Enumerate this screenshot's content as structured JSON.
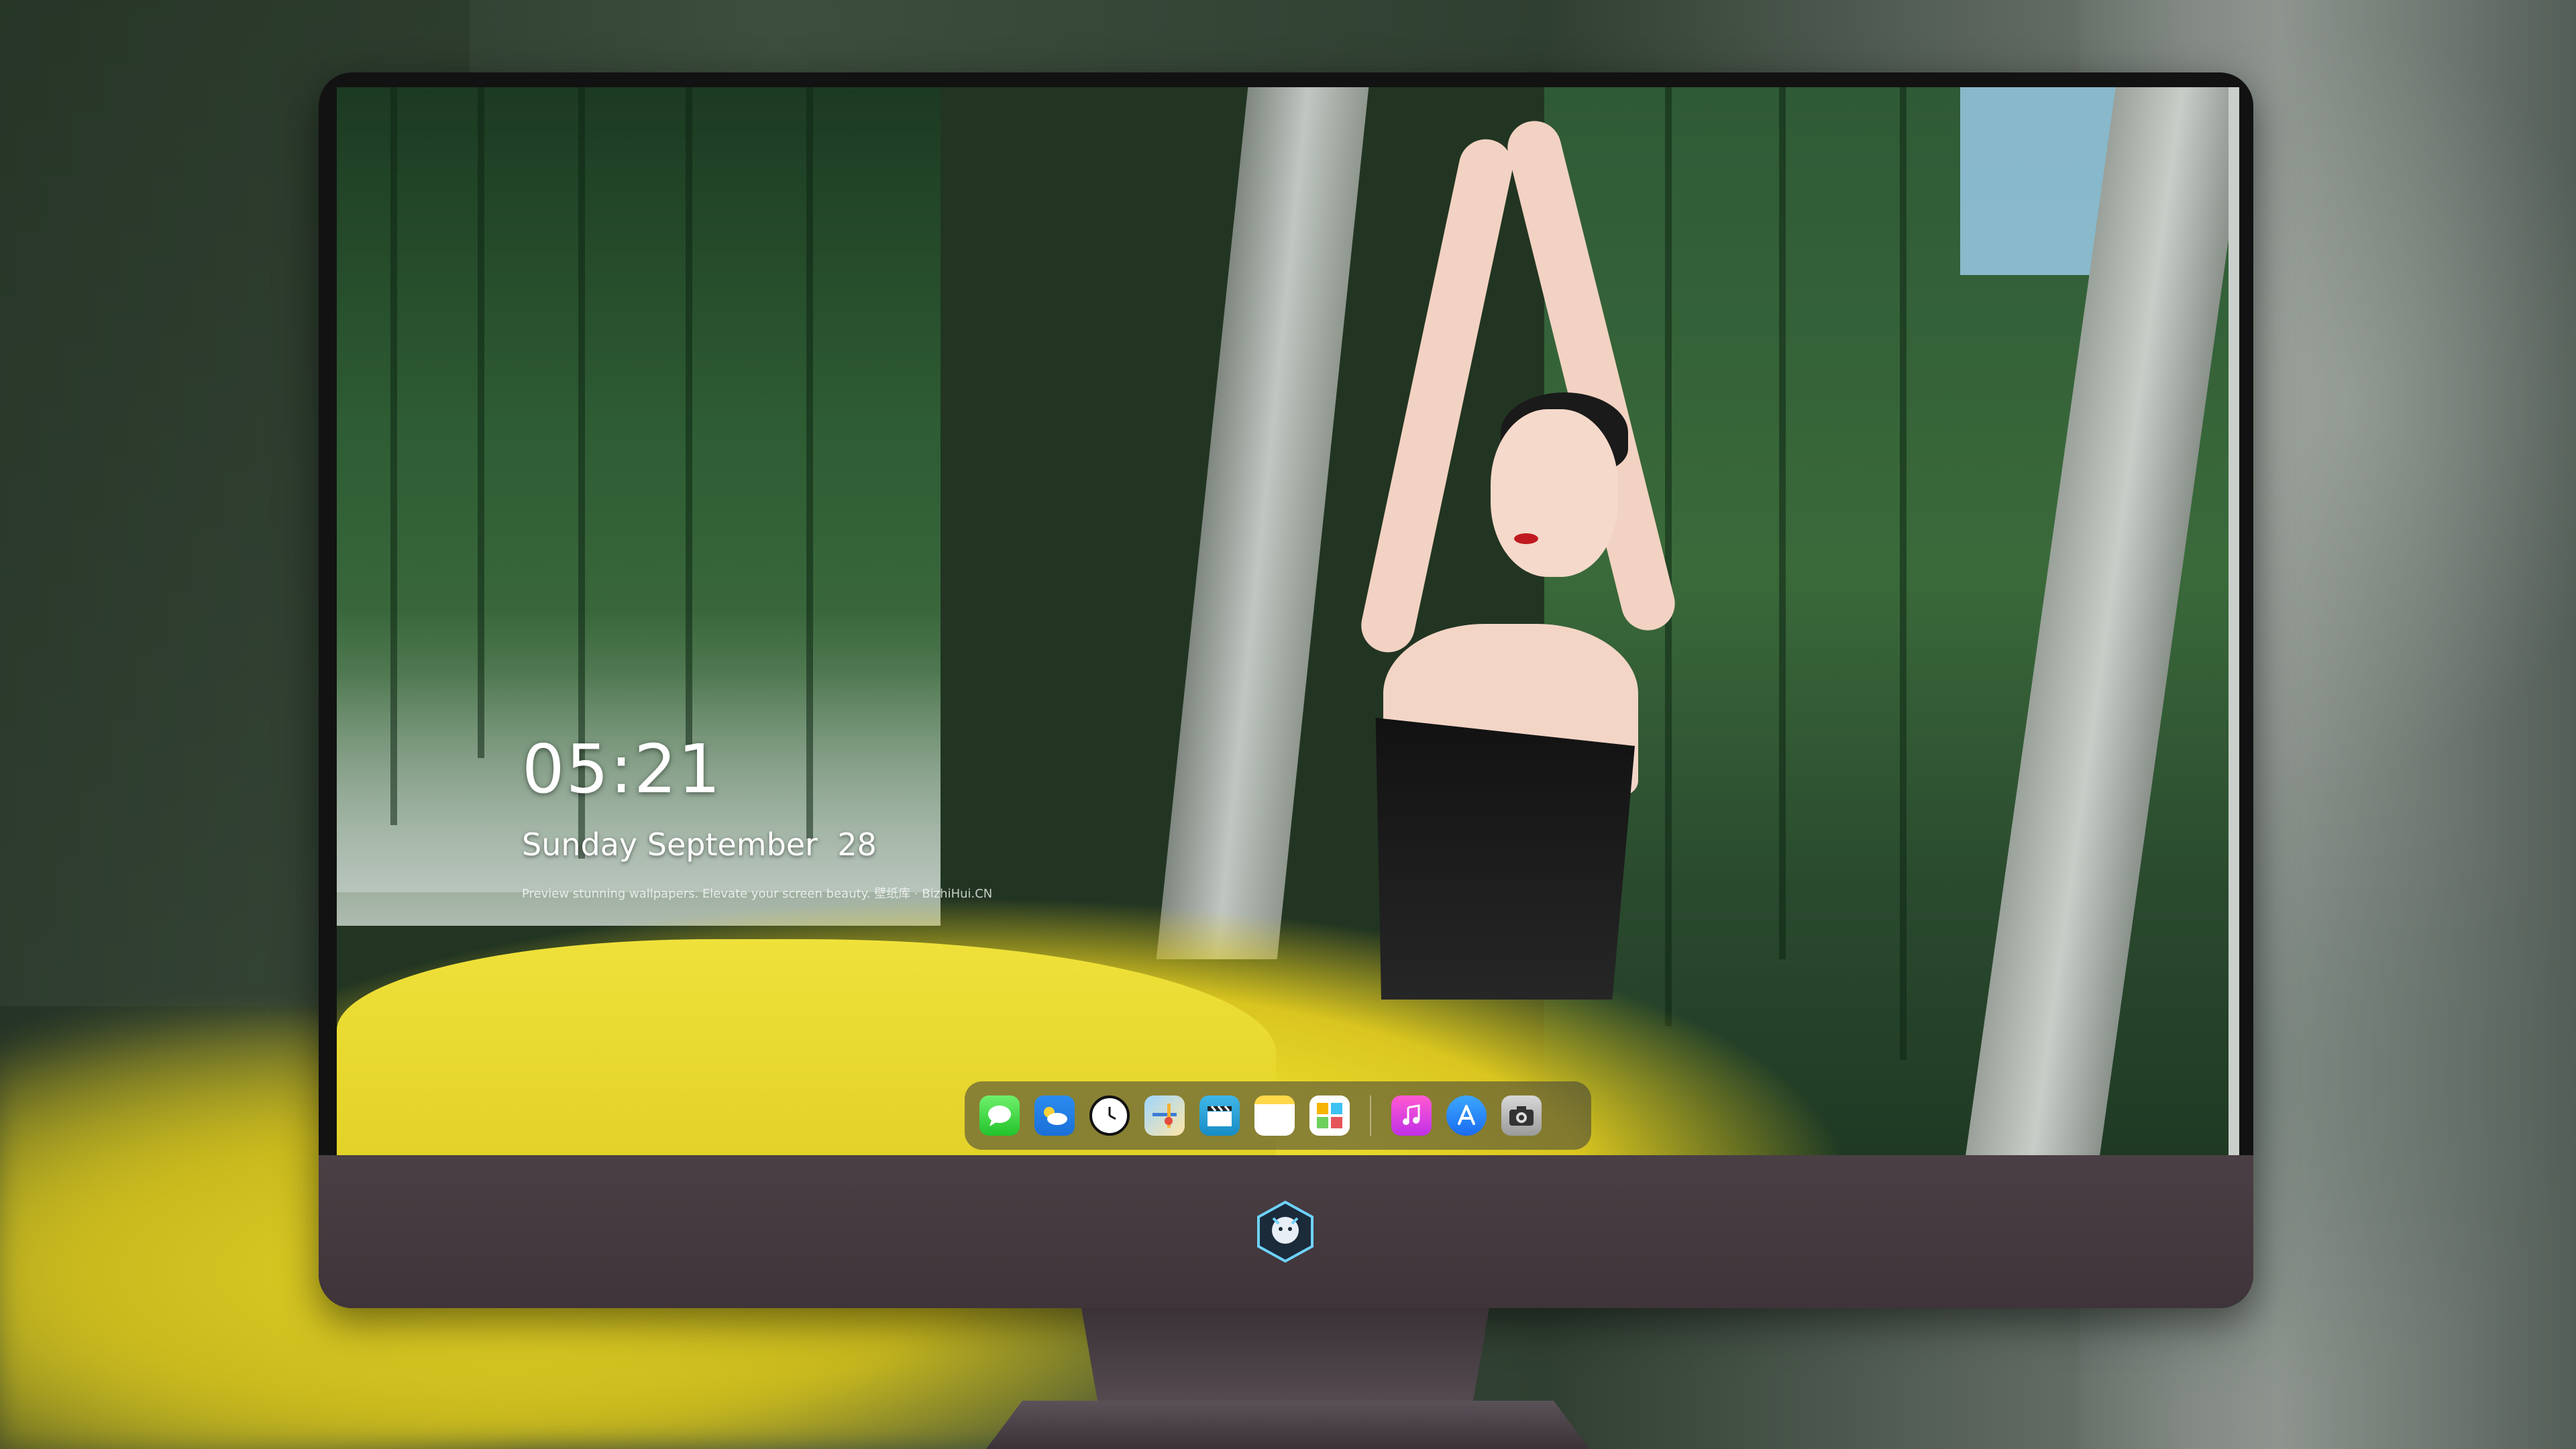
{
  "lockscreen": {
    "time": "05:21",
    "date": "Sunday September  28",
    "caption": "Preview stunning wallpapers. Elevate your screen beauty. 壁纸库 · BizhiHui.CN"
  },
  "dock": {
    "apps": [
      {
        "name": "messages-icon"
      },
      {
        "name": "weather-icon"
      },
      {
        "name": "clock-icon"
      },
      {
        "name": "maps-icon"
      },
      {
        "name": "clapperboard-icon"
      },
      {
        "name": "notes-icon"
      },
      {
        "name": "photos-icon"
      },
      {
        "name": "music-icon"
      },
      {
        "name": "app-store-icon"
      },
      {
        "name": "camera-icon"
      }
    ]
  },
  "colors": {
    "monitor_chin": "#453a3f",
    "dress_yellow": "#e8d82a",
    "dock_bg": "rgba(60,60,60,0.55)"
  }
}
